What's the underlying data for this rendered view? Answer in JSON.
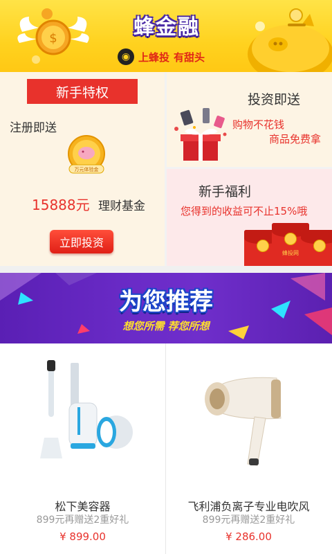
{
  "banner": {
    "brand_title": "蜂金融",
    "slogan_part1": "上蜂投",
    "slogan_part2": "有甜头"
  },
  "promo": {
    "newbie_privilege": {
      "tag": "新手特权",
      "register_text": "注册即送",
      "coin_label": "万元体验金",
      "amount": "15888元",
      "amount_label": "理财基金",
      "button": "立即投资"
    },
    "invest_gift": {
      "title": "投资即送",
      "line1": "购物不花钱",
      "line2": "商品免费拿"
    },
    "newbie_welfare": {
      "title": "新手福利",
      "desc": "您得到的收益可不止15%哦",
      "packet_label": "蜂投网"
    }
  },
  "recommend": {
    "title": "为您推荐",
    "subtitle": "想您所需  荐您所想"
  },
  "products": [
    {
      "name": "松下美容器",
      "promo": "899元再赠送2重好礼",
      "price": "¥ 899.00",
      "icon": "toothbrush-icon"
    },
    {
      "name": "飞利浦负离子专业电吹风",
      "promo": "899元再赠送2重好礼",
      "price": "¥ 286.00",
      "icon": "hairdryer-icon"
    }
  ],
  "colors": {
    "banner_yellow": "#ffd21f",
    "accent_red": "#e8322c",
    "promo_bg": "#fdf4e4",
    "welfare_bg": "#fde9ea",
    "recommend_purple": "#6a2bc7"
  }
}
